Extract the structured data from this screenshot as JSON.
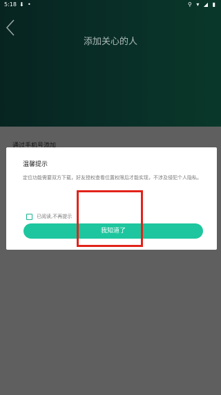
{
  "status_bar": {
    "time": "5:18",
    "download_glyph": "⬇",
    "dot": "•",
    "right_icons": "⚲ ▾ ◢ ▮"
  },
  "header": {
    "title": "添加关心的人",
    "back_icon": "back-chevron-icon"
  },
  "section": {
    "label": "通过手机号添加"
  },
  "dialog": {
    "title": "温馨提示",
    "message": "定位功能需要双方下载，好友授权查看位置权限后才能实现，不涉及侵犯个人隐私。",
    "checkbox_label": "已阅读,不再提示",
    "checkbox_checked": false,
    "ok_button": "我知道了"
  },
  "colors": {
    "accent": "#1dc69e",
    "highlight": "#e2231a"
  }
}
